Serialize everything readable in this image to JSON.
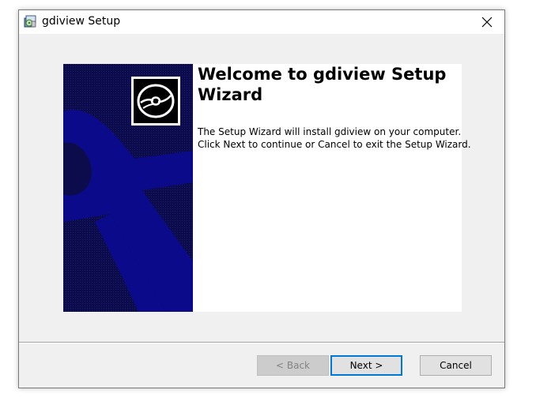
{
  "window": {
    "title": "gdiview Setup",
    "icon": "installer-package-icon",
    "close_icon": "close-icon"
  },
  "wizard": {
    "heading": "Welcome to gdiview Setup Wizard",
    "body": "The Setup Wizard will install gdiview on your computer.  Click Next to continue or Cancel to exit the Setup Wizard.",
    "banner_icon": "disc-icon"
  },
  "buttons": {
    "back": "< Back",
    "next": "Next >",
    "cancel": "Cancel"
  },
  "colors": {
    "banner_dark": "#0c0c4c",
    "banner_accent": "#0a0a8a",
    "focus_border": "#0078d7"
  }
}
